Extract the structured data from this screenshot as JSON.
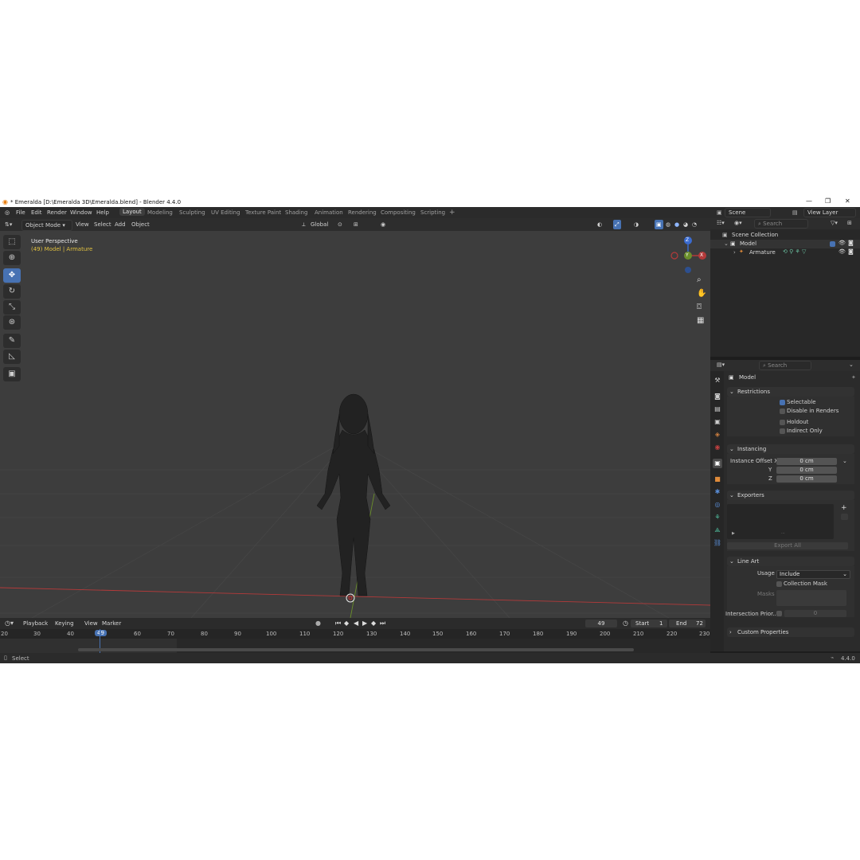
{
  "titlebar": {
    "title": "* Emeralda [D:\\Emeralda 3D\\Emeralda.blend] - Blender 4.4.0",
    "minimize": "—",
    "restore": "❐",
    "close": "✕"
  },
  "menu": [
    "File",
    "Edit",
    "Render",
    "Window",
    "Help"
  ],
  "workspaces": [
    "Layout",
    "Modeling",
    "Sculpting",
    "UV Editing",
    "Texture Paint",
    "Shading",
    "Animation",
    "Rendering",
    "Compositing",
    "Scripting"
  ],
  "workspace_add": "+",
  "scene": {
    "label": "Scene",
    "view_layer": "View Layer"
  },
  "viewport_header": {
    "mode": "Object Mode",
    "menus": [
      "View",
      "Select",
      "Add",
      "Object"
    ],
    "transform": "Global"
  },
  "viewport": {
    "perspective": "User Perspective",
    "context": "(49) Model | Armature",
    "gizmo": {
      "z": "Z",
      "y": "Y",
      "x": "X"
    }
  },
  "outliner": {
    "search_placeholder": "Search",
    "scene_collection": "Scene Collection",
    "collection": "Model",
    "object": "Armature"
  },
  "properties": {
    "search_placeholder": "Search",
    "context_title": "Model",
    "restrictions": {
      "header": "Restrictions",
      "selectable": "Selectable",
      "disable_in_renders": "Disable in Renders",
      "holdout": "Holdout",
      "indirect_only": "Indirect Only",
      "selectable_checked": true
    },
    "instancing": {
      "header": "Instancing",
      "offset_x_label": "Instance Offset X",
      "y_label": "Y",
      "z_label": "Z",
      "x_value": "0 cm",
      "y_value": "0 cm",
      "z_value": "0 cm"
    },
    "exporters": {
      "header": "Exporters",
      "export_all": "Export All"
    },
    "line_art": {
      "header": "Line Art",
      "usage_label": "Usage",
      "usage_value": "Include",
      "collection_mask": "Collection Mask",
      "masks_label": "Masks",
      "intersection_label": "Intersection Prior...",
      "intersection_value": "0"
    },
    "custom_properties": "Custom Properties"
  },
  "timeline": {
    "menus": [
      "Playback",
      "Keying",
      "View",
      "Marker"
    ],
    "current_frame": "49",
    "start_label": "Start",
    "start_value": "1",
    "end_label": "End",
    "end_value": "72",
    "ticks": [
      "20",
      "30",
      "40",
      "49",
      "60",
      "70",
      "80",
      "90",
      "100",
      "110",
      "120",
      "130",
      "140",
      "150",
      "160",
      "170",
      "180",
      "190",
      "200",
      "210",
      "220",
      "230"
    ]
  },
  "statusbar": {
    "left": "Select",
    "version": "4.4.0"
  },
  "colors": {
    "accent": "#4772b3",
    "x_axis": "#b43a3a",
    "y_axis": "#6a8e2a",
    "z_axis": "#3a6bd0",
    "playhead": "#4772b3",
    "context_yellow": "#e0c040"
  }
}
